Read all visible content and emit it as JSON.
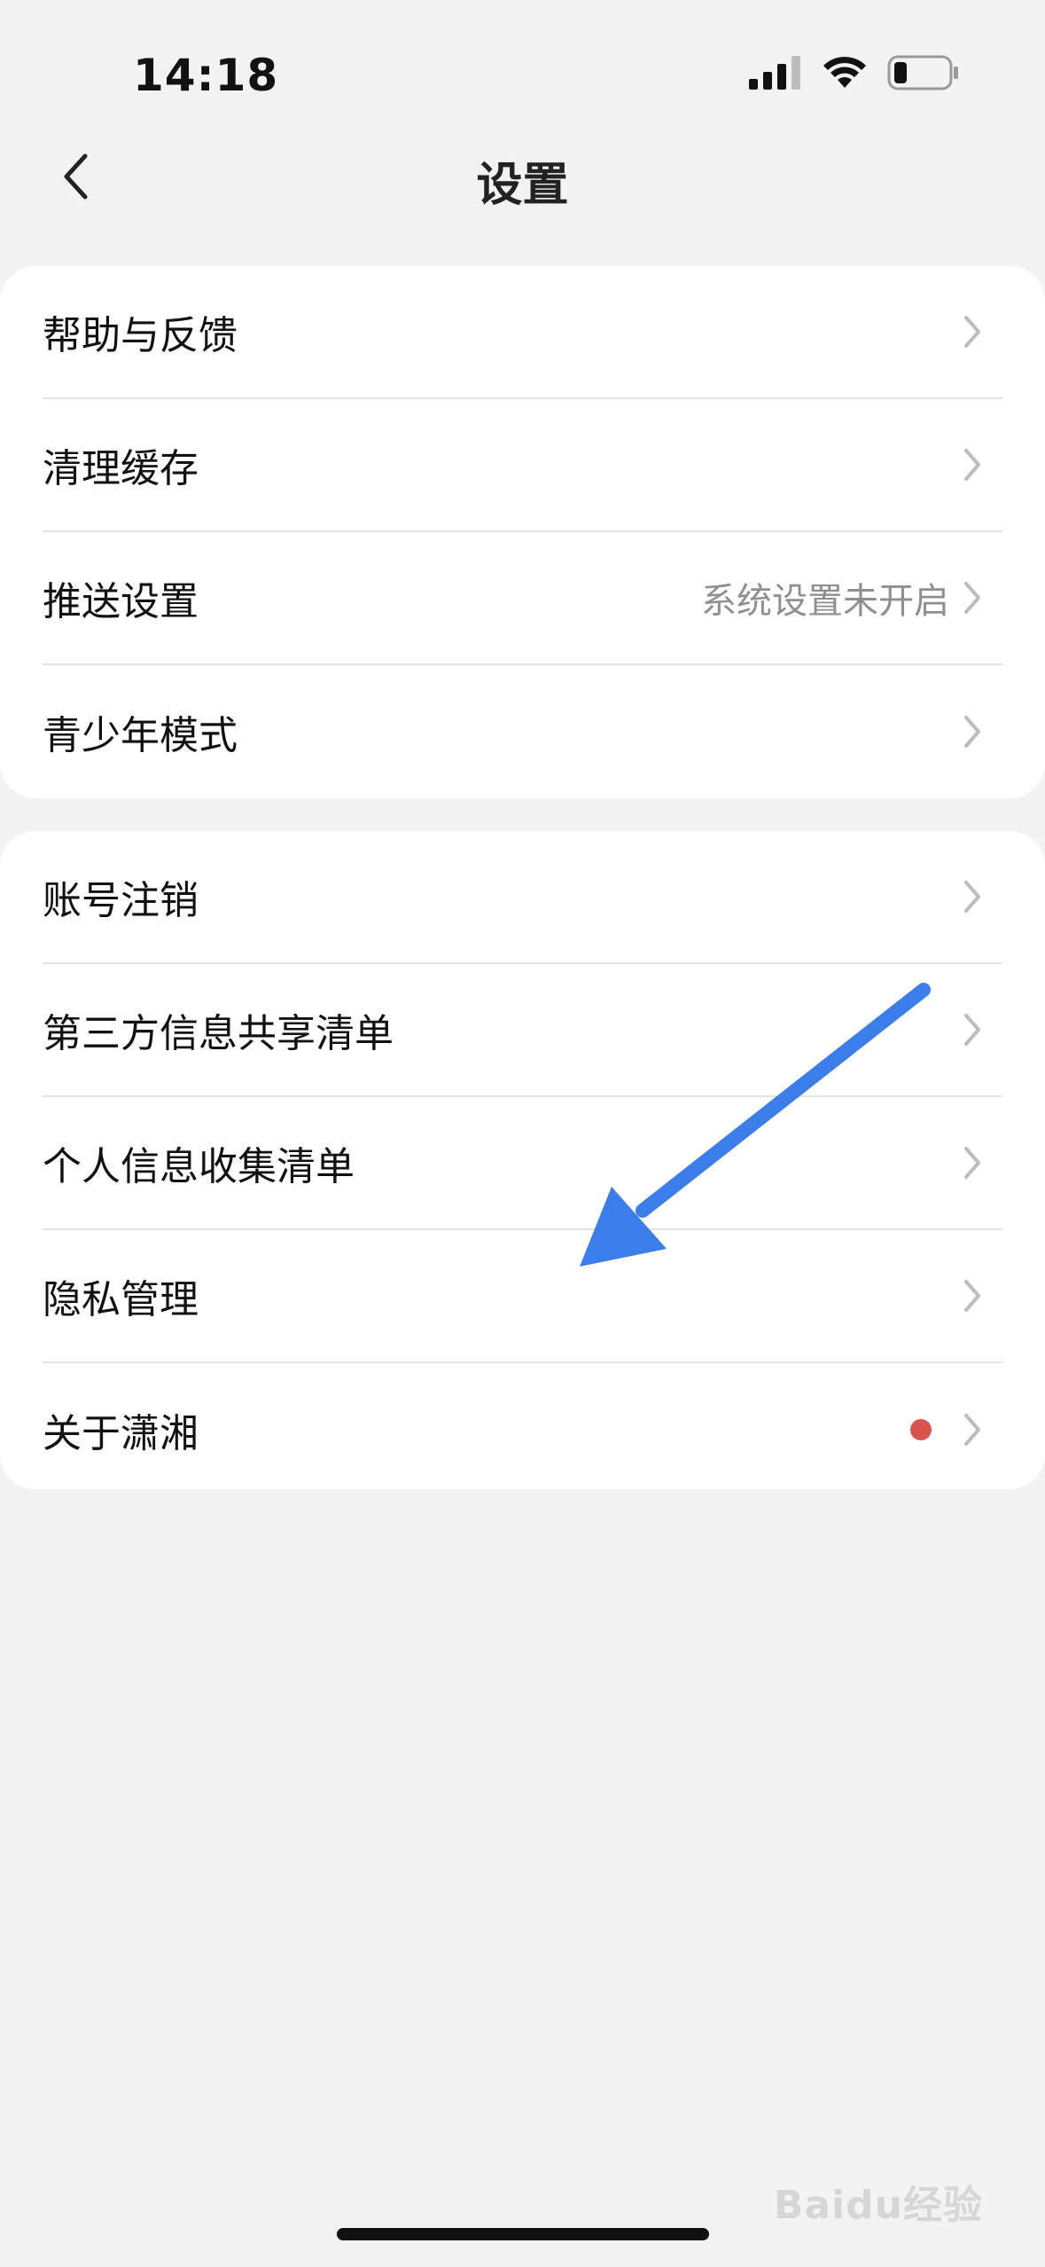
{
  "status_bar": {
    "time": "14:18",
    "icons": [
      "cellular-signal-icon",
      "wifi-icon",
      "battery-icon"
    ]
  },
  "nav": {
    "title": "设置",
    "back_icon": "chevron-left-icon"
  },
  "groups": [
    {
      "items": [
        {
          "label": "帮助与反馈",
          "value": ""
        },
        {
          "label": "清理缓存",
          "value": ""
        },
        {
          "label": "推送设置",
          "value": "系统设置未开启"
        },
        {
          "label": "青少年模式",
          "value": ""
        }
      ]
    },
    {
      "items": [
        {
          "label": "账号注销",
          "value": ""
        },
        {
          "label": "第三方信息共享清单",
          "value": ""
        },
        {
          "label": "个人信息收集清单",
          "value": ""
        },
        {
          "label": "隐私管理",
          "value": ""
        },
        {
          "label": "关于潇湘",
          "value": "",
          "badge": "red-dot"
        }
      ]
    }
  ],
  "annotation": {
    "type": "arrow",
    "color": "#3b7de9",
    "points_to": "隐私管理"
  },
  "watermark": "Baidu经验",
  "colors": {
    "background": "#f3f3f3",
    "card": "#ffffff",
    "secondary_text": "#8f8f8f",
    "badge_red": "#d9534f"
  }
}
